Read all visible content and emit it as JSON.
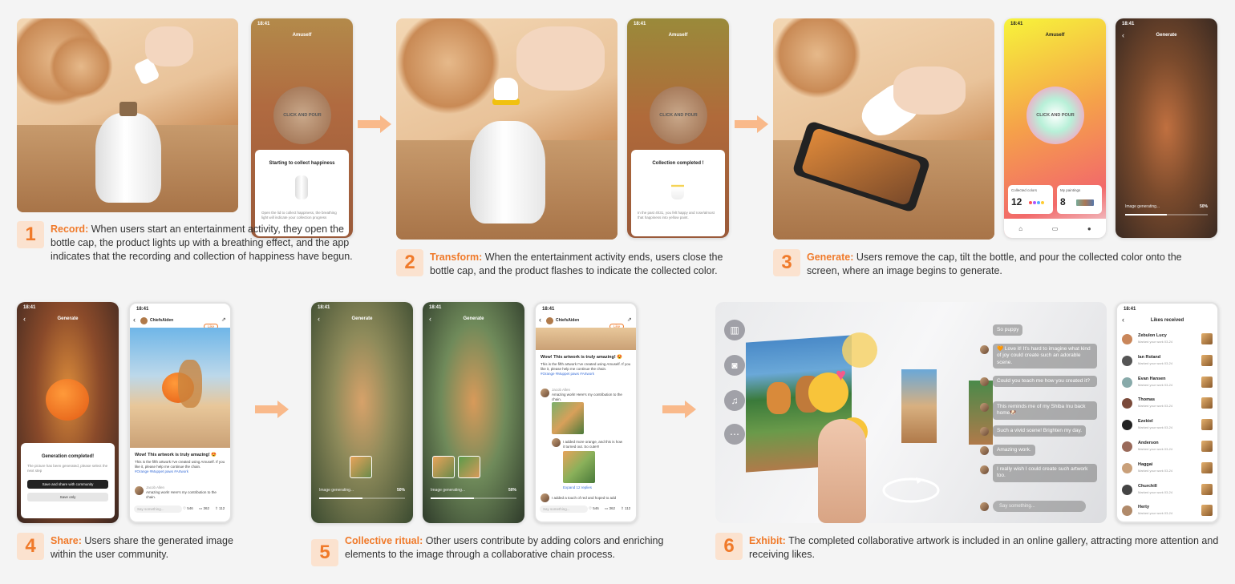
{
  "steps": [
    {
      "num": "1",
      "title": "Record:",
      "text": " When users start an entertainment activity, they open the bottle cap, the product lights up with a breathing effect, and the app indicates that the recording and collection of happiness have begun."
    },
    {
      "num": "2",
      "title": "Transform:",
      "text": " When the entertainment activity ends, users close the bottle cap, and the product flashes to indicate the collected color."
    },
    {
      "num": "3",
      "title": "Generate:",
      "text": " Users remove the cap, tilt the bottle, and pour the collected color onto the screen, where an image begins to generate."
    },
    {
      "num": "4",
      "title": "Share:",
      "text": " Users share the generated image within the user community."
    },
    {
      "num": "5",
      "title": "Collective ritual:",
      "text": " Other users contribute by adding colors and enriching elements to the image through a collaborative chain process."
    },
    {
      "num": "6",
      "title": "Exhibit:",
      "text": " The completed collaborative artwork is included in an online gallery, attracting more attention and receiving likes."
    }
  ],
  "phone": {
    "time": "18:41",
    "app_title": "Amuself",
    "orb_label": "CLICK AND POUR",
    "collect_title": "Starting to collect happiness",
    "collect_text": "Open the lid to collect happiness, the breathing light will indicate your collection progress",
    "completed_title": "Collection completed !",
    "completed_text": "In the past 4h31, you felt happy and rose/almost that happiness into yellow paint.",
    "collected_colors_label": "Collected colors",
    "collected_colors_value": "12",
    "my_paintings_label": "My paintings",
    "my_paintings_value": "8",
    "generate_title": "Generate",
    "generating_label": "Image generating...",
    "progress_text": "50%",
    "progress": 0.5,
    "gen_complete_title": "Generation completed!",
    "gen_complete_text": "The picture has been generated, please select the next step",
    "save_share_btn": "Save and share with community",
    "save_only_btn": "Save only"
  },
  "community": {
    "user": "ChiefsAiden",
    "like_btn": "Like",
    "post_title": "Wow! This artwork is truly amazing! 😍",
    "post_text": "This is the fifth artwork I've created using Amuself. If you like it, please help me continue the chain.",
    "tags": "#Orange #Muppet paws #Artwork",
    "comment_user": "Jacob Allen",
    "comment_text": "Amazing work! Here's my contribution to the chain.",
    "comment_text2": "I added more orange, and this is how it turned out. So cute!!!",
    "expand_label": "Expand 12 replies",
    "comment_text3": "I added a touch of red and hoped to add",
    "say_placeholder": "Say something...",
    "likes_count": "546",
    "comments_count": "362",
    "shares_count": "112"
  },
  "gallery": {
    "comments": [
      "So puppy",
      "🧡 Love it! It's hard to imagine what kind of joy could create such an adorable scene.",
      "Could you teach me how you created it?",
      "This reminds me of my Shiba Inu back home🐶",
      "Such a vivid scene! Brighten my day.",
      "Amazing work.",
      "I really wish I could create such artwork too."
    ],
    "say_placeholder": "Say something..."
  },
  "likes": {
    "title": "Likes received",
    "subtitle": "Marked your work  03-24",
    "users": [
      "Zebulon Lucy",
      "Ian Roland",
      "Evan Hansen",
      "Thomas",
      "Ezekiel",
      "Anderson",
      "Haggai",
      "Churchill",
      "Herty"
    ]
  },
  "colors": {
    "accent": "#f07a2a",
    "accent_light": "#fbe2cf"
  }
}
